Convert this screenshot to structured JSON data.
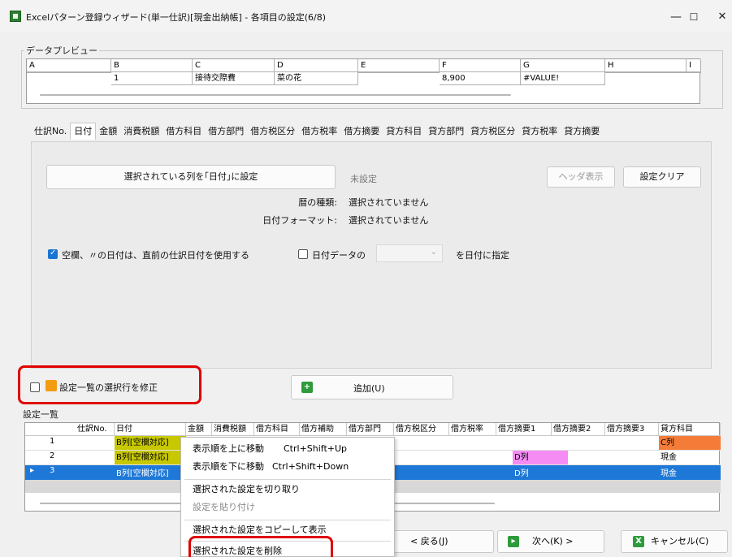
{
  "window": {
    "title": "Excelパターン登録ウィザード(単一仕訳)[現金出納帳] - 各項目の設定(6/8)",
    "minimize": "—",
    "maximize": "☐",
    "close": "✕"
  },
  "data_preview": {
    "label": "データプレビュー",
    "columns": [
      "A",
      "B",
      "C",
      "D",
      "E",
      "F",
      "G",
      "H",
      "I"
    ],
    "row": [
      "",
      "1",
      "接待交際費",
      "菜の花",
      "",
      "8,900",
      "#VALUE!",
      "",
      ""
    ]
  },
  "tabs": [
    "仕訳No.",
    "日付",
    "金額",
    "消費税額",
    "借方科目",
    "借方部門",
    "借方税区分",
    "借方税率",
    "借方摘要",
    "貸方科目",
    "貸方部門",
    "貸方税区分",
    "貸方税率",
    "貸方摘要"
  ],
  "active_tab": "日付",
  "date_panel": {
    "set_button": "選択されている列を｢日付｣に設定",
    "unset_label": "未設定",
    "header_button": "ヘッダ表示",
    "clear_button": "設定クリア",
    "calendar_key": "暦の種類:",
    "calendar_value": "選択されていません",
    "format_key": "日付フォーマット:",
    "format_value": "選択されていません",
    "blank_checkbox_label": "空欄、〃の日付は、直前の仕訳日付を使用する",
    "date_data_checkbox_label": "日付データの",
    "date_data_suffix": "を日付に指定"
  },
  "modify": {
    "checkbox_label": "設定一覧の選択行を修正",
    "add_button": "追加(U)"
  },
  "settings_list": {
    "label": "設定一覧",
    "headers": [
      "",
      "仕訳No.",
      "日付",
      "金額",
      "消費税額",
      "借方科目",
      "借方補助",
      "借方部門",
      "借方税区分",
      "借方税率",
      "借方摘要1",
      "借方摘要2",
      "借方摘要3",
      "貸方科目"
    ],
    "rows": [
      {
        "num": "1",
        "date": "B列[空欄対応]",
        "debit_summary1": "",
        "credit_account": "C列"
      },
      {
        "num": "2",
        "date": "B列[空欄対応]",
        "debit_summary1": "D列",
        "credit_account": "現金"
      },
      {
        "num": "3",
        "date": "B列[空欄対応]",
        "debit_summary1": "D列",
        "credit_account": "現金"
      }
    ],
    "row_marker": "▸"
  },
  "context_menu": {
    "move_up": "表示順を上に移動",
    "move_up_shortcut": "Ctrl+Shift+Up",
    "move_down": "表示順を下に移動",
    "move_down_shortcut": "Ctrl+Shift+Down",
    "cut": "選択された設定を切り取り",
    "paste": "設定を貼り付け",
    "copy_show": "選択された設定をコピーして表示",
    "delete": "選択された設定を削除"
  },
  "nav": {
    "back": "< 戻る(J)",
    "next": "次へ(K) >",
    "cancel": "キャンセル(C)"
  },
  "colors": {
    "yellow_cell": "#c8c800",
    "orange_cell": "#f57c38",
    "pink_cell": "#f48cf4",
    "selected_row": "#1e78d8",
    "highlight_box": "#e00000"
  }
}
